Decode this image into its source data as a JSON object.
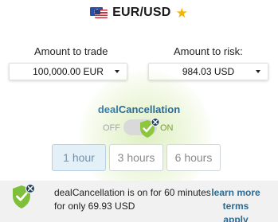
{
  "header": {
    "pair": "EUR/USD",
    "star_color": "#f4b400",
    "flags": [
      "eu-flag-icon",
      "us-flag-icon"
    ]
  },
  "amount_to_trade": {
    "label": "Amount to trade",
    "value": "100,000.00 EUR"
  },
  "amount_to_risk": {
    "label": "Amount to risk:",
    "value": "984.03 USD"
  },
  "deal_cancellation": {
    "title_prefix": "deal",
    "title_main": "Cancellation",
    "off_label": "OFF",
    "on_label": "ON",
    "enabled": true,
    "accent_color": "#8dc63f"
  },
  "durations": [
    {
      "label": "1 hour",
      "selected": true
    },
    {
      "label": "3 hours",
      "selected": false
    },
    {
      "label": "6 hours",
      "selected": false
    }
  ],
  "banner": {
    "line1": "dealCancellation is on for 60 minutes",
    "line2": "for only 69.93 USD",
    "link_line1": "learn more",
    "link_line2": "terms apply",
    "link_color": "#2b6a93"
  }
}
